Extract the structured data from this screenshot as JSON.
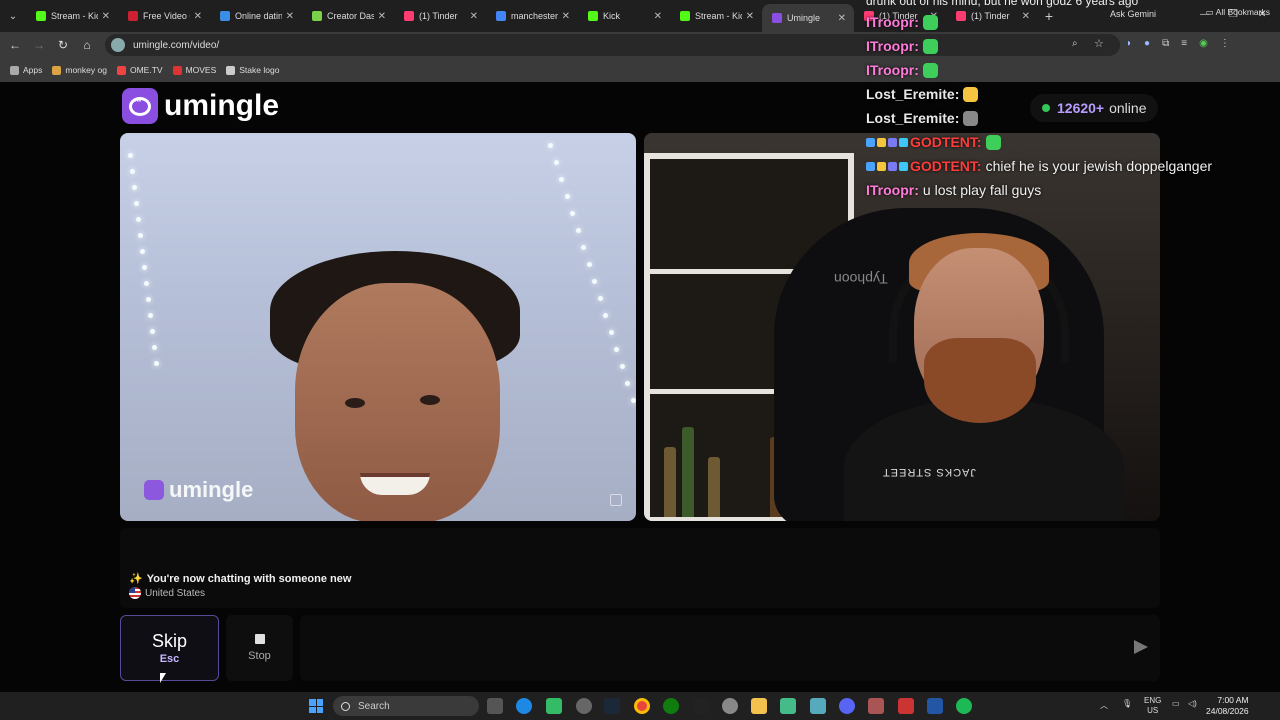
{
  "browser": {
    "tabs": [
      {
        "title": "Stream - Kick",
        "color": "#53fc18"
      },
      {
        "title": "Free Video C",
        "color": "#c23"
      },
      {
        "title": "Online datin",
        "color": "#3a8ee6"
      },
      {
        "title": "Creator Dash",
        "color": "#7bd148"
      },
      {
        "title": "(1) Tinder",
        "color": "#fe3c72"
      },
      {
        "title": "manchester",
        "color": "#4285f4"
      },
      {
        "title": "Kick",
        "color": "#53fc18"
      },
      {
        "title": "Stream - Kick",
        "color": "#53fc18"
      },
      {
        "title": "Umingle",
        "color": "#8a4fe0",
        "active": true
      },
      {
        "title": "(1) Tinder",
        "color": "#fe3c72"
      },
      {
        "title": "(1) Tinder",
        "color": "#fe3c72"
      }
    ],
    "ask_gemini": "Ask Gemini",
    "url": "umingle.com/video/",
    "bookmarks": [
      {
        "label": "Apps",
        "color": "#aaa"
      },
      {
        "label": "monkey og",
        "color": "#d9a441"
      },
      {
        "label": "OME.TV",
        "color": "#e44"
      },
      {
        "label": "MOVES",
        "color": "#d33"
      },
      {
        "label": "Stake logo",
        "color": "#ccc"
      }
    ],
    "all_bookmarks": "All Bookmarks"
  },
  "page": {
    "logo_text": "umingle",
    "online_count": "12620+",
    "online_label": "online",
    "watermark_text": "umingle",
    "status_text": "You're now chatting with someone new",
    "country": "United States",
    "skip_label": "Skip",
    "skip_key": "Esc",
    "stop_label": "Stop",
    "message_placeholder": ""
  },
  "self_video": {
    "chair_brand": "Typhoon",
    "shirt_text": "JACKS STREET"
  },
  "chat": {
    "top_line": "drunk out of his mind, but he won godz 6 years ago",
    "messages": [
      {
        "user": "ITroopr",
        "color": "#ff7ad9",
        "text": "",
        "emote": "#3ecf5a"
      },
      {
        "user": "ITroopr",
        "color": "#ff7ad9",
        "text": "",
        "emote": "#3ecf5a"
      },
      {
        "user": "ITroopr",
        "color": "#ff7ad9",
        "text": "",
        "emote": "#3ecf5a"
      },
      {
        "user": "Lost_Eremite",
        "color": "#e8e8e8",
        "text": "",
        "emote": "#f5c542"
      },
      {
        "user": "Lost_Eremite",
        "color": "#e8e8e8",
        "text": "",
        "emote": "#888888"
      },
      {
        "user": "GODTENT",
        "color": "#ff3b3b",
        "text": "",
        "emote": "#3ecf5a",
        "badges": true
      },
      {
        "user": "GODTENT",
        "color": "#ff3b3b",
        "text": "chief he is your jewish doppelganger",
        "badges": true
      },
      {
        "user": "ITroopr",
        "color": "#ff7ad9",
        "text": "u lost play fall guys"
      }
    ]
  },
  "taskbar": {
    "search_label": "Search",
    "language": "ENG",
    "region": "US",
    "time": "7:00 AM",
    "date": "24/08/2026"
  }
}
